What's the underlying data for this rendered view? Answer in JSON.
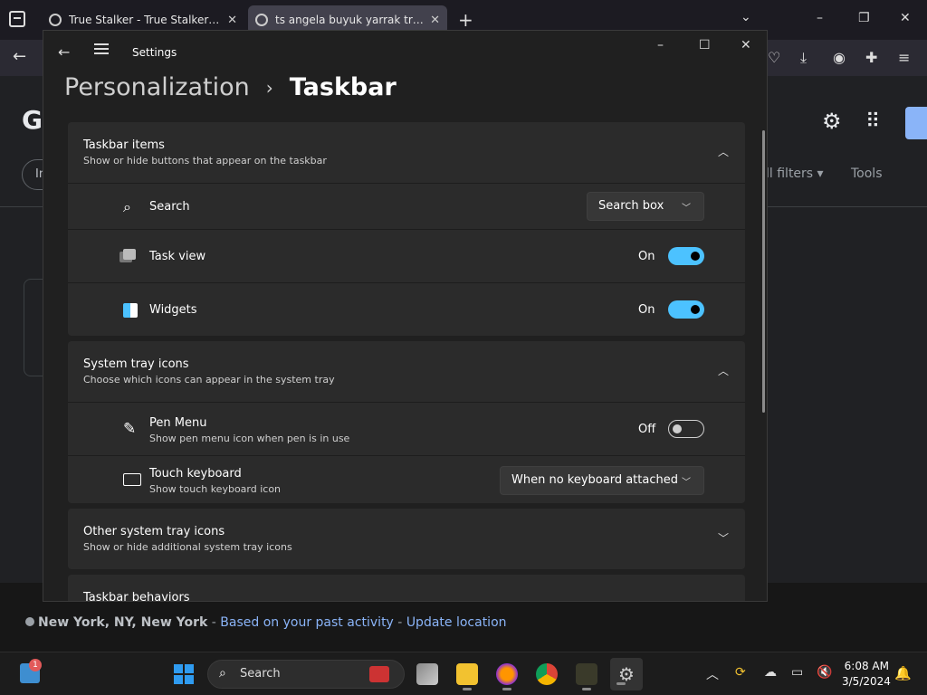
{
  "browser": {
    "tabs": [
      {
        "title": "True Stalker - True Stalker - AP"
      },
      {
        "title": "ts angela buyuk yarrak trans - G"
      }
    ],
    "new_tab": "+",
    "list_all_tabs": "⌄",
    "close_tab": "✕",
    "window_controls": {
      "minimize": "–",
      "maximize": "❐",
      "close": "✕"
    }
  },
  "google_page": {
    "logo_letter": "G",
    "filter_pill_text": "In",
    "all_filters": "ll filters ▾",
    "tools": "Tools",
    "location": {
      "city": "New York, NY, New York",
      "sep1": " - ",
      "based_on": "Based on your past activity",
      "sep2": " - ",
      "update": "Update location"
    }
  },
  "settings": {
    "window_title": "Settings",
    "controls": {
      "minimize": "–",
      "maximize": "☐",
      "close": "✕"
    },
    "breadcrumb": {
      "parent": "Personalization",
      "sep": "›",
      "current": "Taskbar"
    },
    "taskbar_items": {
      "title": "Taskbar items",
      "subtitle": "Show or hide buttons that appear on the taskbar",
      "search": {
        "label": "Search",
        "value": "Search box"
      },
      "task_view": {
        "label": "Task view",
        "state": "On"
      },
      "widgets": {
        "label": "Widgets",
        "state": "On"
      }
    },
    "system_tray": {
      "title": "System tray icons",
      "subtitle": "Choose which icons can appear in the system tray",
      "pen_menu": {
        "label": "Pen Menu",
        "sub": "Show pen menu icon when pen is in use",
        "state": "Off"
      },
      "touch_keyboard": {
        "label": "Touch keyboard",
        "sub": "Show touch keyboard icon",
        "value": "When no keyboard attached"
      }
    },
    "other_tray": {
      "title": "Other system tray icons",
      "subtitle": "Show or hide additional system tray icons"
    },
    "behaviors": {
      "title": "Taskbar behaviors"
    }
  },
  "taskbar": {
    "notification_count": "1",
    "search_label": "Search",
    "time": "6:08 AM",
    "date": "3/5/2024"
  },
  "colors": {
    "accent": "#4cc2ff",
    "link": "#8ab4f8"
  }
}
